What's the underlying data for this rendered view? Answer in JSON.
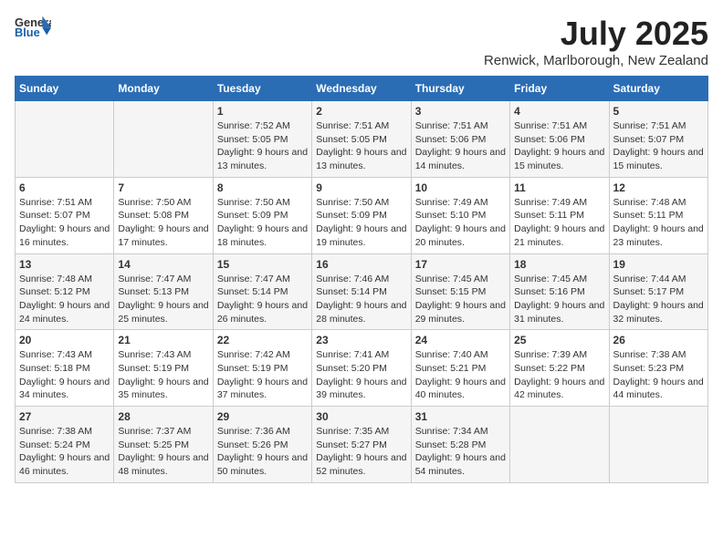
{
  "logo": {
    "general": "General",
    "blue": "Blue"
  },
  "title": "July 2025",
  "location": "Renwick, Marlborough, New Zealand",
  "days_of_week": [
    "Sunday",
    "Monday",
    "Tuesday",
    "Wednesday",
    "Thursday",
    "Friday",
    "Saturday"
  ],
  "weeks": [
    [
      {
        "day": "",
        "info": ""
      },
      {
        "day": "",
        "info": ""
      },
      {
        "day": "1",
        "info": "Sunrise: 7:52 AM\nSunset: 5:05 PM\nDaylight: 9 hours and 13 minutes."
      },
      {
        "day": "2",
        "info": "Sunrise: 7:51 AM\nSunset: 5:05 PM\nDaylight: 9 hours and 13 minutes."
      },
      {
        "day": "3",
        "info": "Sunrise: 7:51 AM\nSunset: 5:06 PM\nDaylight: 9 hours and 14 minutes."
      },
      {
        "day": "4",
        "info": "Sunrise: 7:51 AM\nSunset: 5:06 PM\nDaylight: 9 hours and 15 minutes."
      },
      {
        "day": "5",
        "info": "Sunrise: 7:51 AM\nSunset: 5:07 PM\nDaylight: 9 hours and 15 minutes."
      }
    ],
    [
      {
        "day": "6",
        "info": "Sunrise: 7:51 AM\nSunset: 5:07 PM\nDaylight: 9 hours and 16 minutes."
      },
      {
        "day": "7",
        "info": "Sunrise: 7:50 AM\nSunset: 5:08 PM\nDaylight: 9 hours and 17 minutes."
      },
      {
        "day": "8",
        "info": "Sunrise: 7:50 AM\nSunset: 5:09 PM\nDaylight: 9 hours and 18 minutes."
      },
      {
        "day": "9",
        "info": "Sunrise: 7:50 AM\nSunset: 5:09 PM\nDaylight: 9 hours and 19 minutes."
      },
      {
        "day": "10",
        "info": "Sunrise: 7:49 AM\nSunset: 5:10 PM\nDaylight: 9 hours and 20 minutes."
      },
      {
        "day": "11",
        "info": "Sunrise: 7:49 AM\nSunset: 5:11 PM\nDaylight: 9 hours and 21 minutes."
      },
      {
        "day": "12",
        "info": "Sunrise: 7:48 AM\nSunset: 5:11 PM\nDaylight: 9 hours and 23 minutes."
      }
    ],
    [
      {
        "day": "13",
        "info": "Sunrise: 7:48 AM\nSunset: 5:12 PM\nDaylight: 9 hours and 24 minutes."
      },
      {
        "day": "14",
        "info": "Sunrise: 7:47 AM\nSunset: 5:13 PM\nDaylight: 9 hours and 25 minutes."
      },
      {
        "day": "15",
        "info": "Sunrise: 7:47 AM\nSunset: 5:14 PM\nDaylight: 9 hours and 26 minutes."
      },
      {
        "day": "16",
        "info": "Sunrise: 7:46 AM\nSunset: 5:14 PM\nDaylight: 9 hours and 28 minutes."
      },
      {
        "day": "17",
        "info": "Sunrise: 7:45 AM\nSunset: 5:15 PM\nDaylight: 9 hours and 29 minutes."
      },
      {
        "day": "18",
        "info": "Sunrise: 7:45 AM\nSunset: 5:16 PM\nDaylight: 9 hours and 31 minutes."
      },
      {
        "day": "19",
        "info": "Sunrise: 7:44 AM\nSunset: 5:17 PM\nDaylight: 9 hours and 32 minutes."
      }
    ],
    [
      {
        "day": "20",
        "info": "Sunrise: 7:43 AM\nSunset: 5:18 PM\nDaylight: 9 hours and 34 minutes."
      },
      {
        "day": "21",
        "info": "Sunrise: 7:43 AM\nSunset: 5:19 PM\nDaylight: 9 hours and 35 minutes."
      },
      {
        "day": "22",
        "info": "Sunrise: 7:42 AM\nSunset: 5:19 PM\nDaylight: 9 hours and 37 minutes."
      },
      {
        "day": "23",
        "info": "Sunrise: 7:41 AM\nSunset: 5:20 PM\nDaylight: 9 hours and 39 minutes."
      },
      {
        "day": "24",
        "info": "Sunrise: 7:40 AM\nSunset: 5:21 PM\nDaylight: 9 hours and 40 minutes."
      },
      {
        "day": "25",
        "info": "Sunrise: 7:39 AM\nSunset: 5:22 PM\nDaylight: 9 hours and 42 minutes."
      },
      {
        "day": "26",
        "info": "Sunrise: 7:38 AM\nSunset: 5:23 PM\nDaylight: 9 hours and 44 minutes."
      }
    ],
    [
      {
        "day": "27",
        "info": "Sunrise: 7:38 AM\nSunset: 5:24 PM\nDaylight: 9 hours and 46 minutes."
      },
      {
        "day": "28",
        "info": "Sunrise: 7:37 AM\nSunset: 5:25 PM\nDaylight: 9 hours and 48 minutes."
      },
      {
        "day": "29",
        "info": "Sunrise: 7:36 AM\nSunset: 5:26 PM\nDaylight: 9 hours and 50 minutes."
      },
      {
        "day": "30",
        "info": "Sunrise: 7:35 AM\nSunset: 5:27 PM\nDaylight: 9 hours and 52 minutes."
      },
      {
        "day": "31",
        "info": "Sunrise: 7:34 AM\nSunset: 5:28 PM\nDaylight: 9 hours and 54 minutes."
      },
      {
        "day": "",
        "info": ""
      },
      {
        "day": "",
        "info": ""
      }
    ]
  ]
}
